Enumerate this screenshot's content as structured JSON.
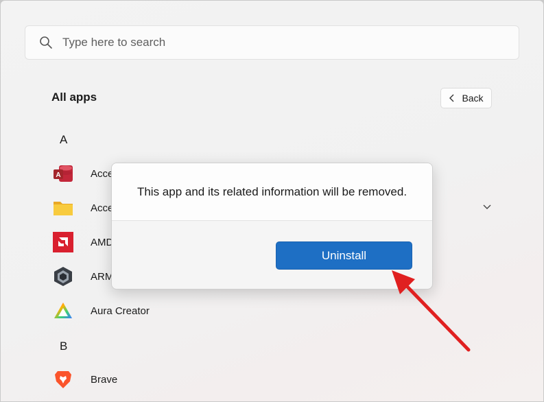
{
  "search": {
    "placeholder": "Type here to search",
    "icon": "search-icon"
  },
  "header": {
    "title": "All apps",
    "back_label": "Back"
  },
  "sections": [
    {
      "letter": "A"
    },
    {
      "letter": "B"
    }
  ],
  "apps": [
    {
      "label": "Acce",
      "icon": "microsoft-access-icon"
    },
    {
      "label": "Acce",
      "icon": "folder-icon"
    },
    {
      "label": "AMD",
      "icon": "amd-icon"
    },
    {
      "label": "ARM",
      "icon": "armoury-crate-icon"
    },
    {
      "label": "Aura Creator",
      "icon": "aura-creator-icon"
    },
    {
      "label": "Brave",
      "icon": "brave-icon"
    }
  ],
  "dialog": {
    "message": "This app and its related information will be removed.",
    "uninstall_label": "Uninstall"
  },
  "colors": {
    "accent": "#1e6fc4",
    "annotation_arrow": "#e02020"
  }
}
